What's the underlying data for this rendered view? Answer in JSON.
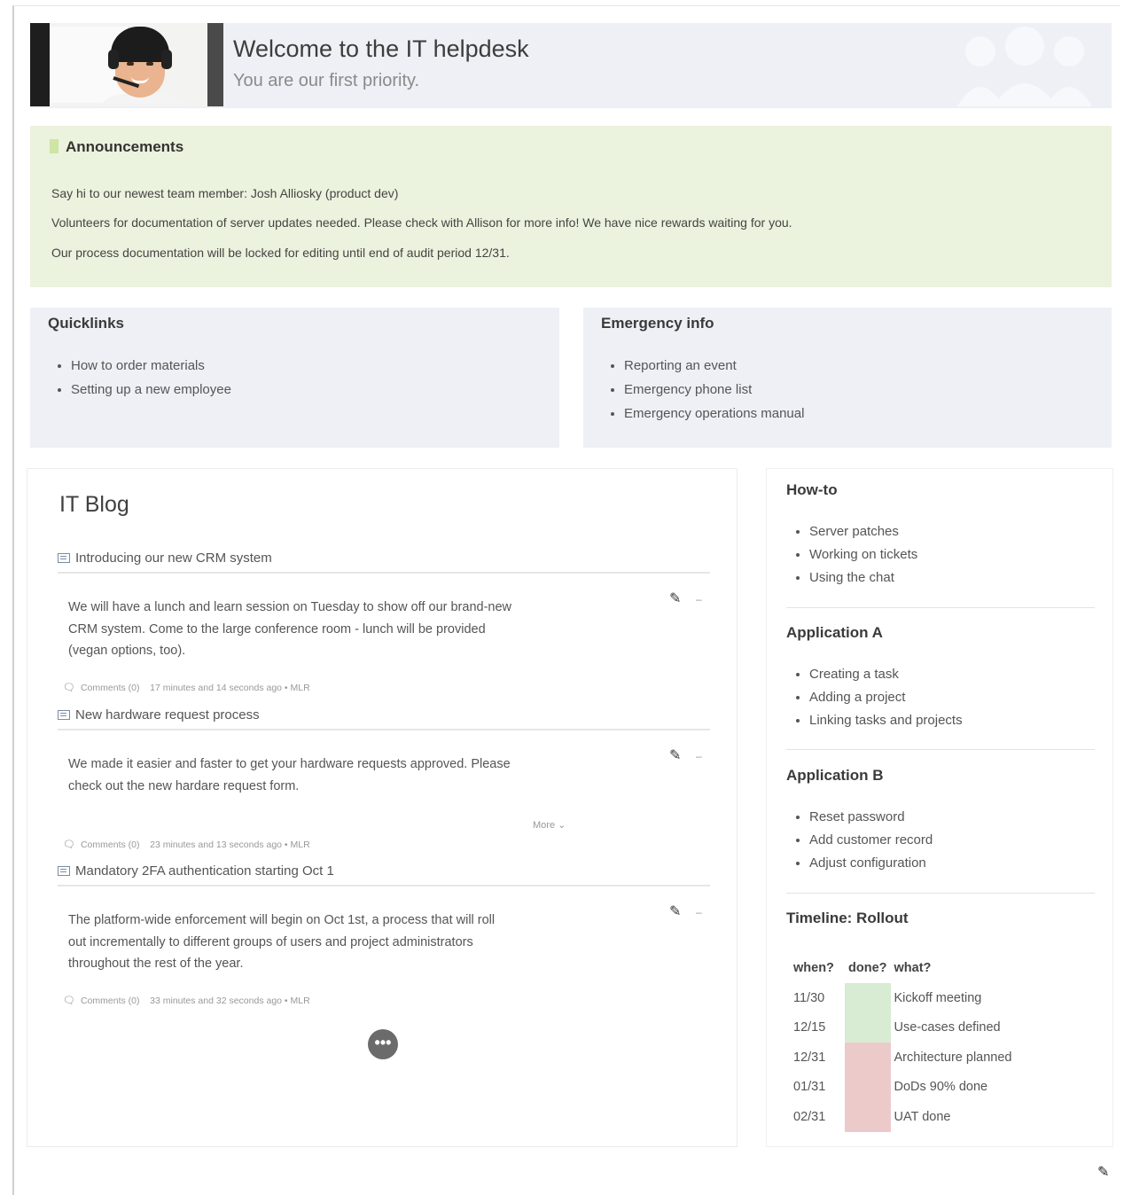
{
  "banner": {
    "title": "Welcome to the IT helpdesk",
    "subtitle": "You are our first priority."
  },
  "announcements": {
    "heading": "Announcements",
    "lines": [
      "Say hi to our newest team member: Josh Alliosky (product dev)",
      "Volunteers for documentation of server updates needed. Please check with Allison for more info! We have nice rewards waiting for you.",
      "Our process documentation will be locked for editing until end of audit period 12/31."
    ]
  },
  "quicklinks": {
    "heading": "Quicklinks",
    "items": [
      "How to order materials",
      "Setting up a new employee"
    ]
  },
  "emergency": {
    "heading": "Emergency info",
    "items": [
      "Reporting an event",
      "Emergency phone list",
      "Emergency operations manual"
    ]
  },
  "blog": {
    "heading": "IT Blog",
    "posts": [
      {
        "title": "Introducing our new CRM system",
        "body_lines": [
          "We will have a lunch and learn session on Tuesday to show off our brand-new",
          "CRM system. Come to the large conference room - lunch will be provided",
          "(vegan options, too)."
        ],
        "comments": "Comments (0)",
        "meta": "17 minutes and 14 seconds ago • MLR"
      },
      {
        "title": "New hardware request process",
        "body_lines": [
          "We made it easier and faster to get your hardware requests approved. Please",
          "check out the new hardare request form."
        ],
        "more": "More",
        "comments": "Comments (0)",
        "meta": "23 minutes and 13 seconds ago • MLR"
      },
      {
        "title": "Mandatory 2FA authentication starting Oct 1",
        "body_lines": [
          "The platform-wide enforcement will begin on Oct 1st, a process that will roll",
          "out incrementally to different groups of users and project administrators",
          "throughout the rest of the year."
        ],
        "comments": "Comments (0)",
        "meta": "33 minutes and 32 seconds ago • MLR"
      }
    ],
    "more_button": "•••"
  },
  "howto": {
    "heading": "How-to",
    "items": [
      "Server patches",
      "Working on tickets",
      "Using the chat"
    ]
  },
  "app_a": {
    "heading": "Application A",
    "items": [
      "Creating a task",
      "Adding a project",
      "Linking tasks and projects"
    ]
  },
  "app_b": {
    "heading": "Application B",
    "items": [
      "Reset password",
      "Add customer record",
      "Adjust configuration"
    ]
  },
  "timeline": {
    "heading": "Timeline: Rollout",
    "columns": [
      "when?",
      "done?",
      "what?"
    ],
    "rows": [
      {
        "when": "11/30",
        "status": "done",
        "what": "Kickoff meeting"
      },
      {
        "when": "12/15",
        "status": "done",
        "what": "Use-cases defined"
      },
      {
        "when": "12/31",
        "status": "not-done",
        "what": "Architecture planned"
      },
      {
        "when": "01/31",
        "status": "not-done",
        "what": "DoDs 90% done"
      },
      {
        "when": "02/31",
        "status": "not-done",
        "what": "UAT done"
      }
    ],
    "colors": {
      "done": "#d7ecd2",
      "not-done": "#edcaca"
    }
  },
  "icons": {
    "edit": "pencil-icon",
    "comment": "comment-icon",
    "news": "news-icon",
    "flag": "flag-icon",
    "team": "team-icon"
  }
}
